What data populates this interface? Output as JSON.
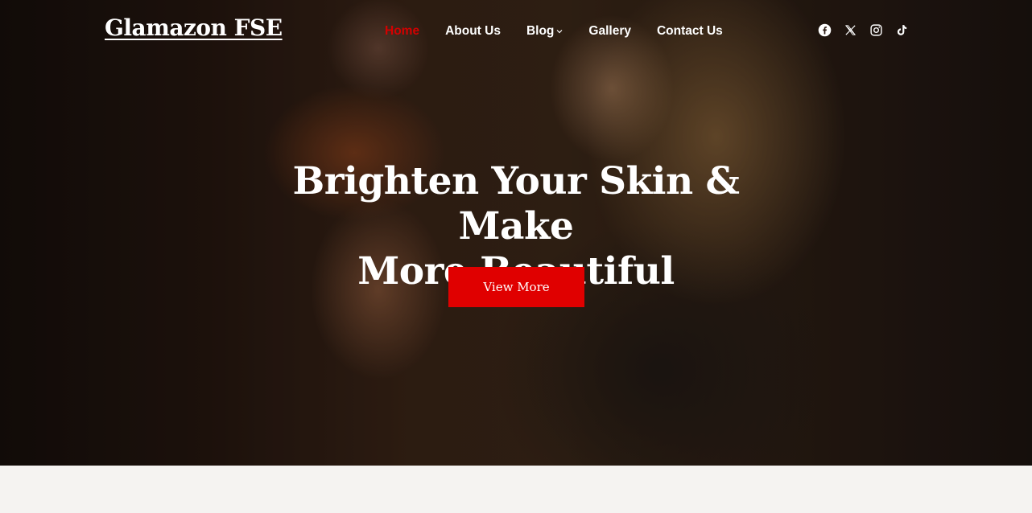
{
  "site": {
    "title": "Glamazon FSE"
  },
  "nav": {
    "items": [
      {
        "label": "Home",
        "active": true
      },
      {
        "label": "About Us"
      },
      {
        "label": "Blog",
        "has_dropdown": true
      },
      {
        "label": "Gallery"
      },
      {
        "label": "Contact Us"
      }
    ]
  },
  "social": [
    "facebook-icon",
    "x-icon",
    "instagram-icon",
    "tiktok-icon"
  ],
  "hero": {
    "headline_line1": "Brighten Your Skin & Make",
    "headline_line2": "More Beautiful",
    "cta_label": "View More"
  },
  "colors": {
    "accent": "#e00000",
    "active_nav": "#d40000",
    "text": "#ffffff",
    "page_bg": "#f5f3f1"
  }
}
